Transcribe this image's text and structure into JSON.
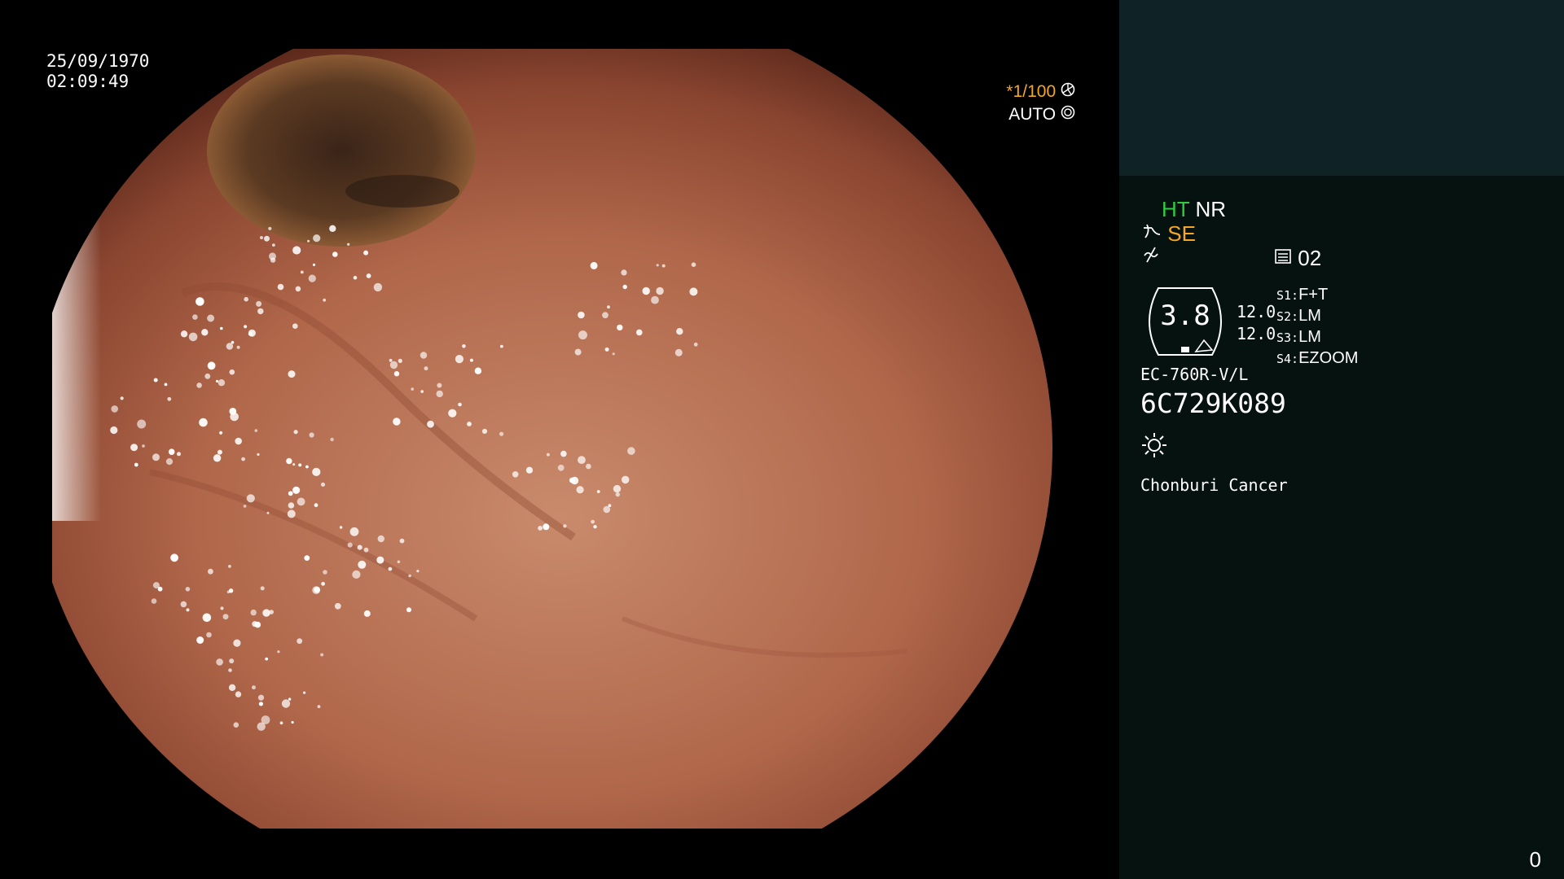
{
  "overlay": {
    "date": "25/09/1970",
    "time": "02:09:49",
    "shutter": "*1/100",
    "iris": "AUTO"
  },
  "panel": {
    "mode_ht": "HT",
    "mode_nr": "NR",
    "mode_se": "SE",
    "zoom_value": "02",
    "dial_value": "3.8",
    "enhance": [
      "12.0",
      "12.0"
    ],
    "switches": [
      {
        "key": "S1:",
        "value": "F+T"
      },
      {
        "key": "S2:",
        "value": "LM"
      },
      {
        "key": "S3:",
        "value": "LM"
      },
      {
        "key": "S4:",
        "value": "EZOOM"
      }
    ],
    "model": "EC-760R-V/L",
    "serial": "6C729K089",
    "hospital": "Chonburi Cancer",
    "counter": "0"
  },
  "colors": {
    "accent_green": "#2ecc40",
    "accent_orange": "#f5a623",
    "panel_bg": "#061210",
    "panel_top_bg": "#0f2326"
  },
  "icons": [
    "shutter-icon",
    "iris-icon",
    "scope-bend-icon",
    "freeze-icon",
    "zoom-icon",
    "brightness-icon"
  ]
}
